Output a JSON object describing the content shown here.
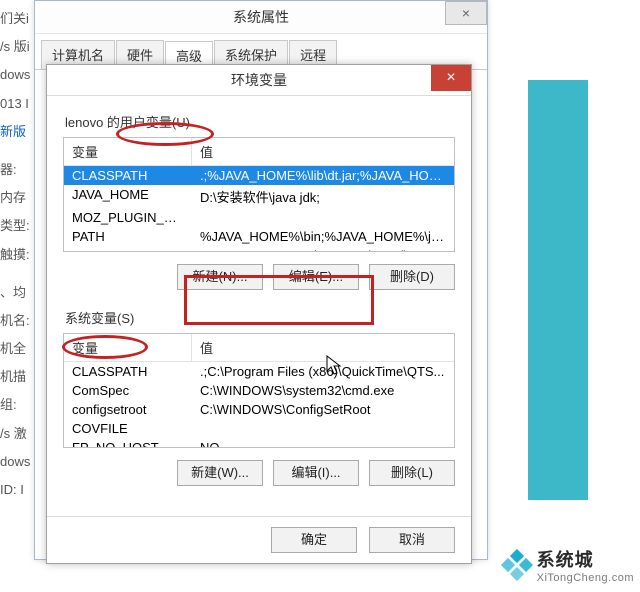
{
  "left": [
    "们关i",
    "/s 版i",
    "dows",
    "013 I",
    "新版",
    "",
    "器:",
    "内存",
    "类型:",
    "触摸:",
    "",
    "、均",
    "机名:",
    "机全",
    "机描",
    "组:",
    "/s 激",
    "dows",
    "ID: I"
  ],
  "sysprops": {
    "title": "系统属性",
    "tabs": [
      "计算机名",
      "硬件",
      "高级",
      "系统保护",
      "远程"
    ]
  },
  "env": {
    "title": "环境变量",
    "user_label": "lenovo 的用户变量(U)",
    "sys_label": "系统变量(S)",
    "hdr_var": "变量",
    "hdr_val": "值",
    "user_vars": [
      {
        "name": "CLASSPATH",
        "value": ".;%JAVA_HOME%\\lib\\dt.jar;%JAVA_HOM..."
      },
      {
        "name": "JAVA_HOME",
        "value": "D:\\安装软件\\java jdk;"
      },
      {
        "name": "MOZ_PLUGIN_PA...",
        "value": ""
      },
      {
        "name": "PATH",
        "value": "%JAVA_HOME%\\bin;%JAVA_HOME%\\jre..."
      },
      {
        "name": "TEMP",
        "value": "%USERPROFILE%\\AppData\\Local\\Temp"
      }
    ],
    "sys_vars": [
      {
        "name": "CLASSPATH",
        "value": ".;C:\\Program Files (x86)\\QuickTime\\QTS..."
      },
      {
        "name": "ComSpec",
        "value": "C:\\WINDOWS\\system32\\cmd.exe"
      },
      {
        "name": "configsetroot",
        "value": "C:\\WINDOWS\\ConfigSetRoot"
      },
      {
        "name": "COVFILE",
        "value": ""
      },
      {
        "name": "FP_NO_HOST_CH",
        "value": "NO"
      }
    ],
    "btns_user": {
      "new": "新建(N)...",
      "edit": "编辑(E)...",
      "del": "删除(D)"
    },
    "btns_sys": {
      "new": "新建(W)...",
      "edit": "编辑(I)...",
      "del": "删除(L)"
    },
    "ok": "确定",
    "cancel": "取消"
  },
  "watermark": {
    "name": "系统城",
    "url": "XiTongCheng.com"
  }
}
